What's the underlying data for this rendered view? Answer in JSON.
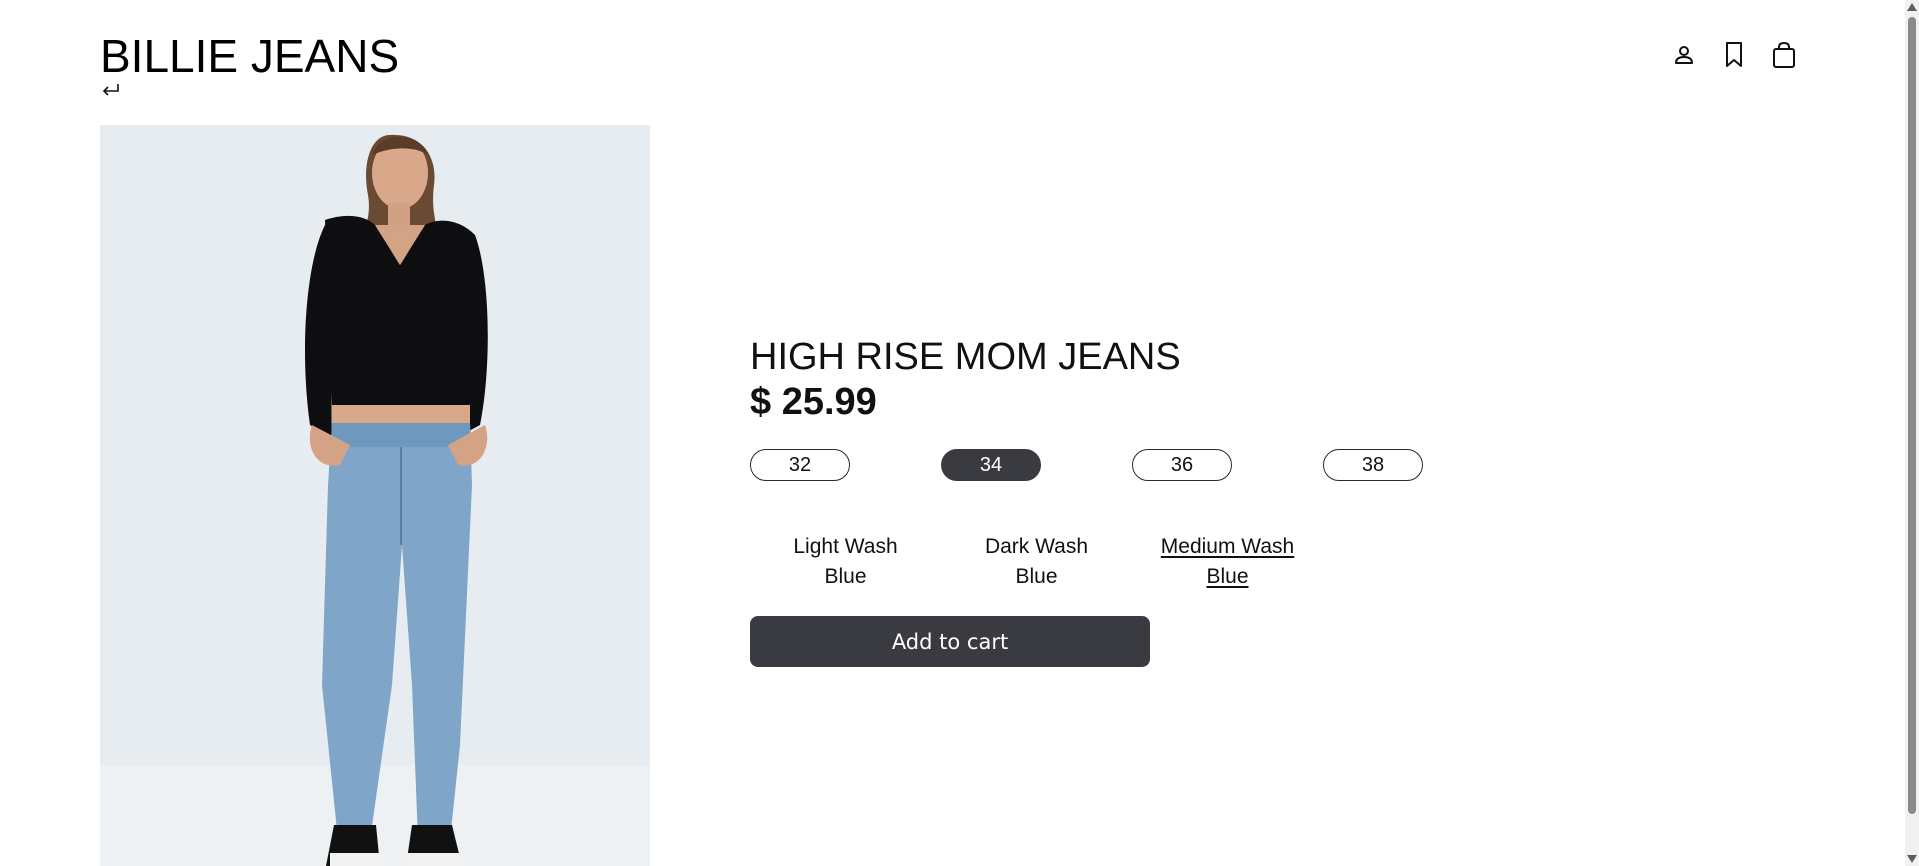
{
  "brand": {
    "name": "BILLIE JEANS"
  },
  "nav": {
    "back_icon": "return-arrow-icon",
    "icons": [
      "user-icon",
      "bookmark-icon",
      "shopping-bag-icon"
    ]
  },
  "product": {
    "title": "HIGH RISE MOM JEANS",
    "price": "$ 25.99",
    "image_alt": "model-wearing-high-rise-mom-jeans",
    "sizes": [
      {
        "label": "32",
        "selected": false
      },
      {
        "label": "34",
        "selected": true
      },
      {
        "label": "36",
        "selected": false
      },
      {
        "label": "38",
        "selected": false
      }
    ],
    "colors": [
      {
        "label": "Light Wash Blue",
        "selected": false
      },
      {
        "label": "Dark Wash Blue",
        "selected": false
      },
      {
        "label": "Medium Wash Blue",
        "selected": true
      }
    ],
    "add_to_cart_label": "Add to cart"
  },
  "theme": {
    "accent": "#3a3b40",
    "background": "#ffffff",
    "image_backdrop": "#e8eef2"
  }
}
